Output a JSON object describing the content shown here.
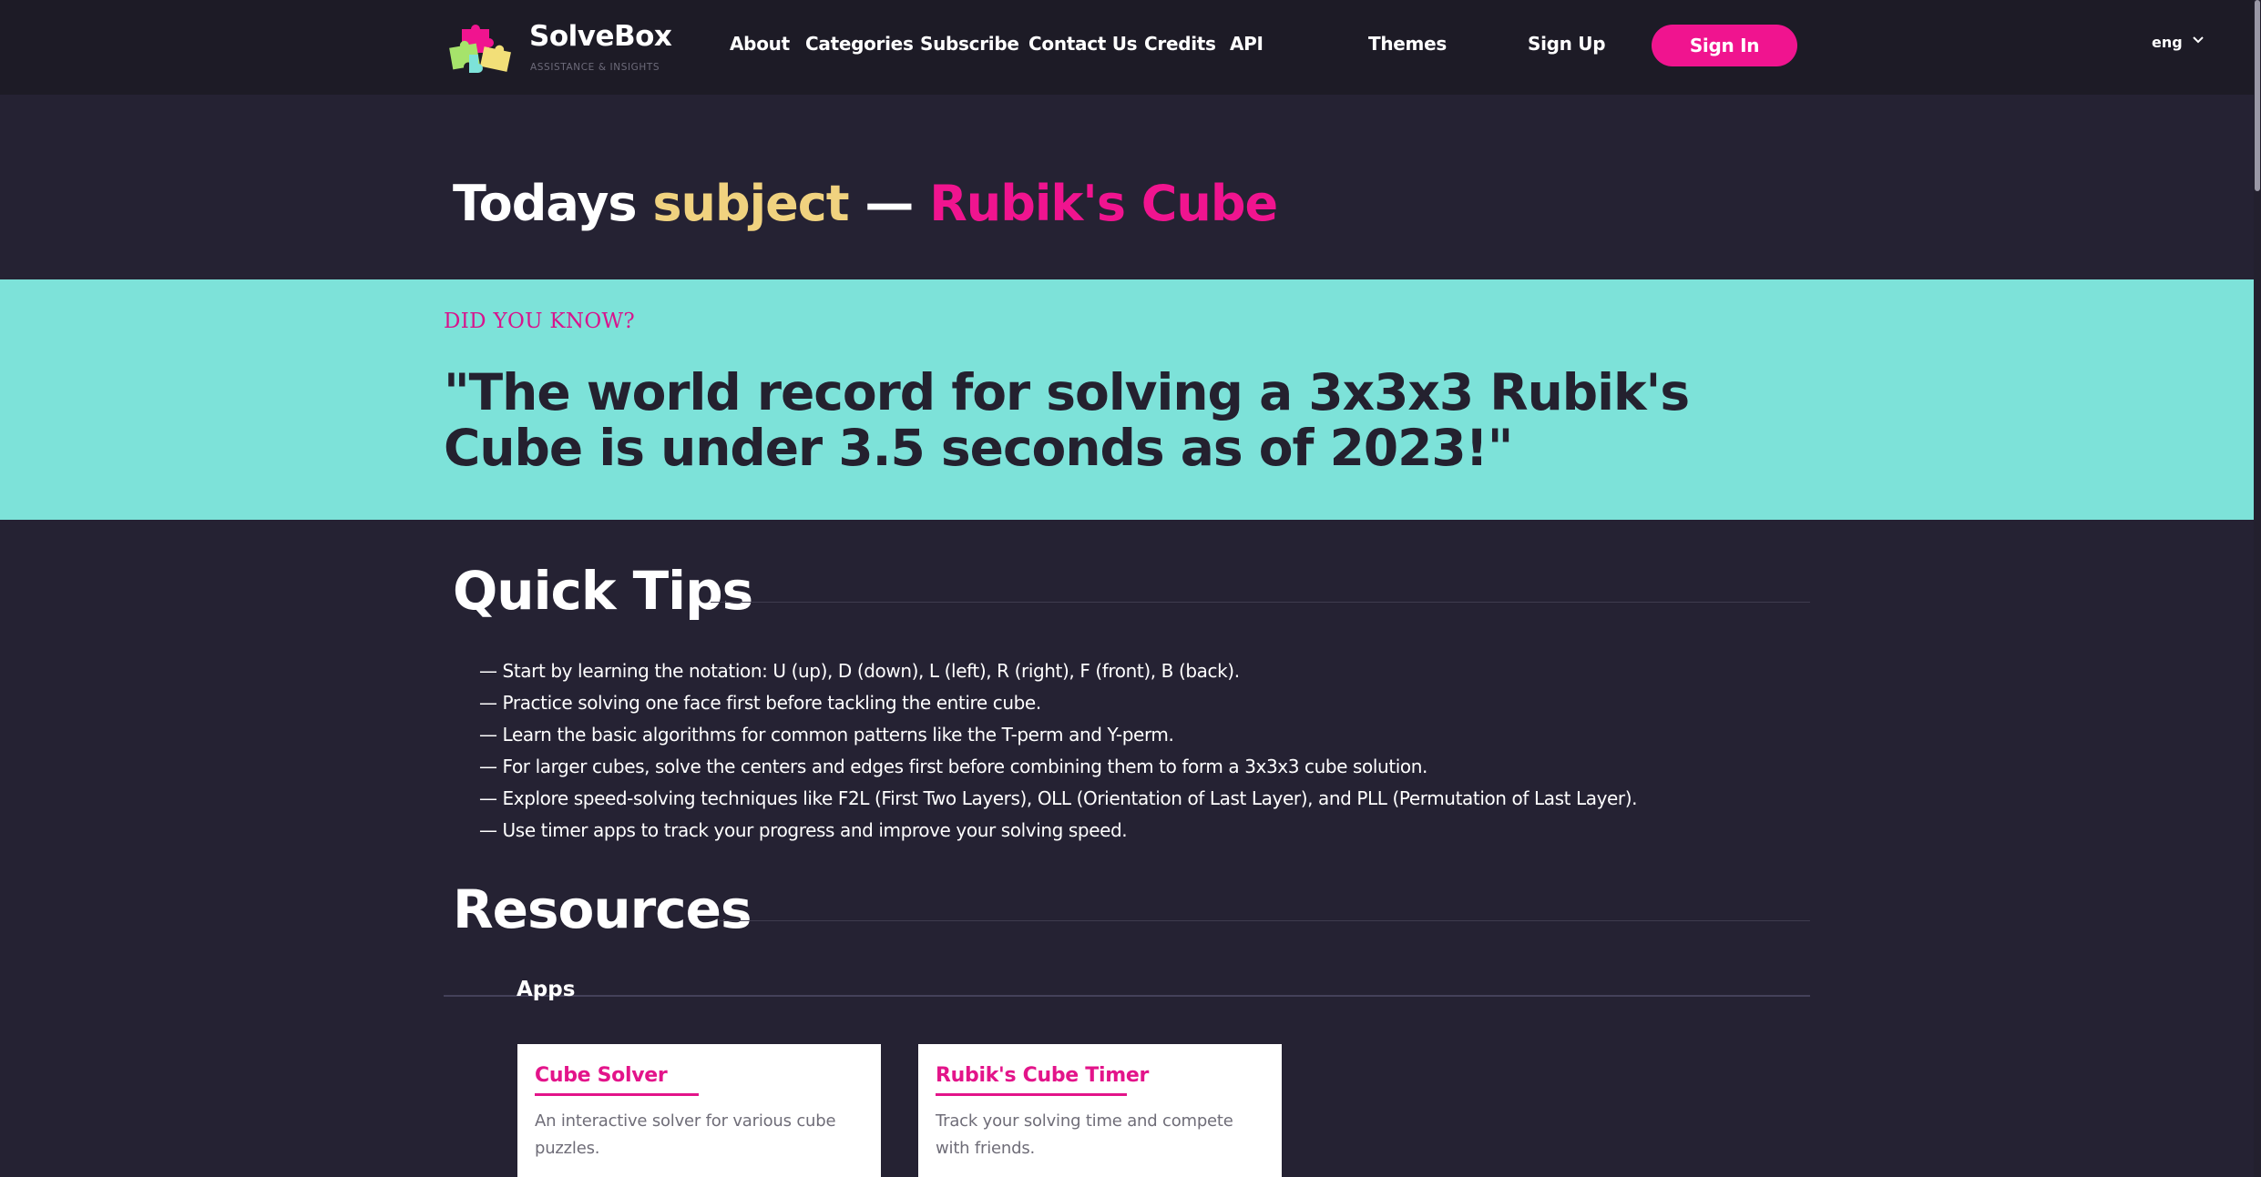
{
  "header": {
    "brand_name": "SolveBox",
    "brand_tagline": "ASSISTANCE & INSIGHTS",
    "nav": [
      "About",
      "Categories",
      "Subscribe",
      "Contact Us",
      "Credits",
      "API",
      "Themes",
      "Sign Up"
    ],
    "sign_in": "Sign In",
    "language": "eng"
  },
  "subject": {
    "w1": "Todays",
    "w2": "subject",
    "w3": "—",
    "w4": "Rubik's Cube"
  },
  "did_you_know": {
    "label": "DID YOU KNOW?",
    "quote": "\"The world record for solving a 3x3x3 Rubik's Cube is under 3.5 seconds as of 2023!\""
  },
  "quick_tips": {
    "title": "Quick Tips",
    "items": [
      "— Start by learning the notation: U (up), D (down), L (left), R (right), F (front), B (back).",
      "— Practice solving one face first before tackling the entire cube.",
      "— Learn the basic algorithms for common patterns like the T-perm and Y-perm.",
      "— For larger cubes, solve the centers and edges first before combining them to form a 3x3x3 cube solution.",
      "— Explore speed-solving techniques like F2L (First Two Layers), OLL (Orientation of Last Layer), and PLL (Permutation of Last Layer).",
      "— Use timer apps to track your progress and improve your solving speed."
    ]
  },
  "resources": {
    "title": "Resources",
    "apps_label": "Apps",
    "cards": [
      {
        "title": "Cube Solver",
        "desc": "An interactive solver for various cube puzzles."
      },
      {
        "title": "Rubik's Cube Timer",
        "desc": "Track your solving time and compete with friends."
      }
    ]
  },
  "colors": {
    "accent_pink": "#f0148f",
    "accent_yellow": "#f0d27f",
    "banner_teal": "#7de2d9",
    "background": "#252233",
    "header_bg": "#1d1b26"
  },
  "icons": [
    "puzzle-logo-icon",
    "chevron-down-icon"
  ]
}
